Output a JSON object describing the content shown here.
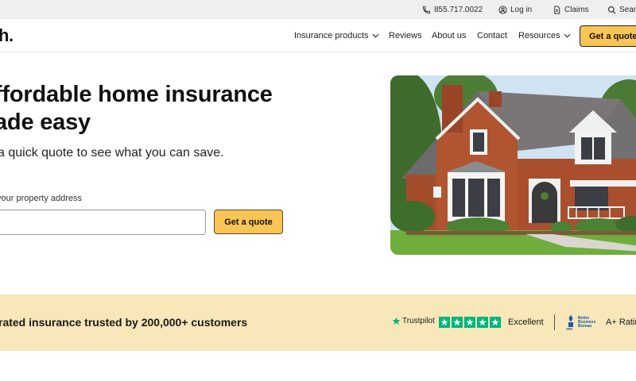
{
  "utility": {
    "phone": "855.717.0022",
    "login": "Log in",
    "claims": "Claims",
    "search": "Search"
  },
  "nav": {
    "logo": "h.",
    "items": [
      "Insurance products",
      "Reviews",
      "About us",
      "Contact",
      "Resources"
    ],
    "cta": "Get a quote"
  },
  "hero": {
    "headline": "ffordable home insurance ade easy",
    "headline_line1": "ffordable home insurance",
    "headline_line2": "ade easy",
    "subheadline": "a quick quote to see what you can save.",
    "address_label": "your property address",
    "address_value": "",
    "cta": "Get a quote"
  },
  "trust": {
    "text": "rated insurance trusted by 200,000+ customers",
    "trustpilot_label": "Trustpilot",
    "trustpilot_rating": "Excellent",
    "trustpilot_stars": 5,
    "bbb_label": "Better Business Bureau",
    "bbb_rating": "A+ Rating"
  },
  "colors": {
    "accent": "#fbc556",
    "trust_band": "#f7e7b9",
    "trustpilot_green": "#00b67a",
    "utility_bar": "#efefef"
  }
}
